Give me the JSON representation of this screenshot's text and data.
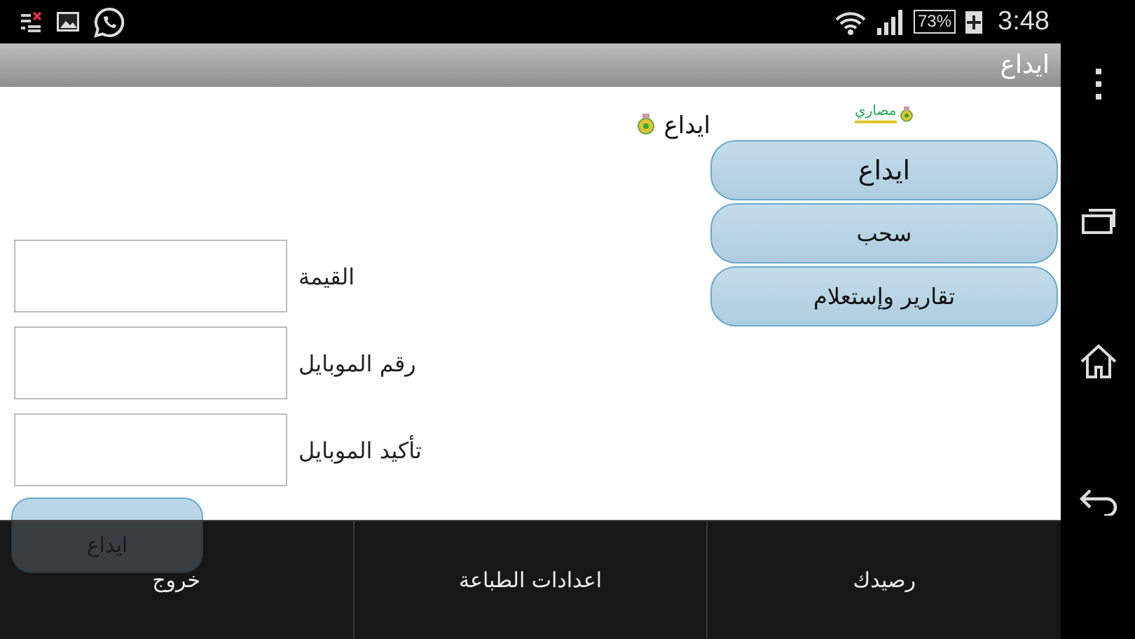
{
  "status_bar": {
    "battery": "73%",
    "time": "3:48"
  },
  "title_bar": {
    "title": "ايداع"
  },
  "logo": {
    "text": "مصاري"
  },
  "header": {
    "title": "ايداع"
  },
  "nav_buttons": [
    {
      "label": "ايداع"
    },
    {
      "label": "سحب"
    },
    {
      "label": "تقارير وإستعلام"
    }
  ],
  "form": {
    "fields": [
      {
        "label": "القيمة"
      },
      {
        "label": "رقم الموبايل"
      },
      {
        "label": "تأكيد الموبايل"
      }
    ],
    "submit": "ايداع"
  },
  "options_menu": [
    {
      "label": "رصيدك"
    },
    {
      "label": "اعدادات الطباعة"
    },
    {
      "label": "خروج"
    }
  ]
}
